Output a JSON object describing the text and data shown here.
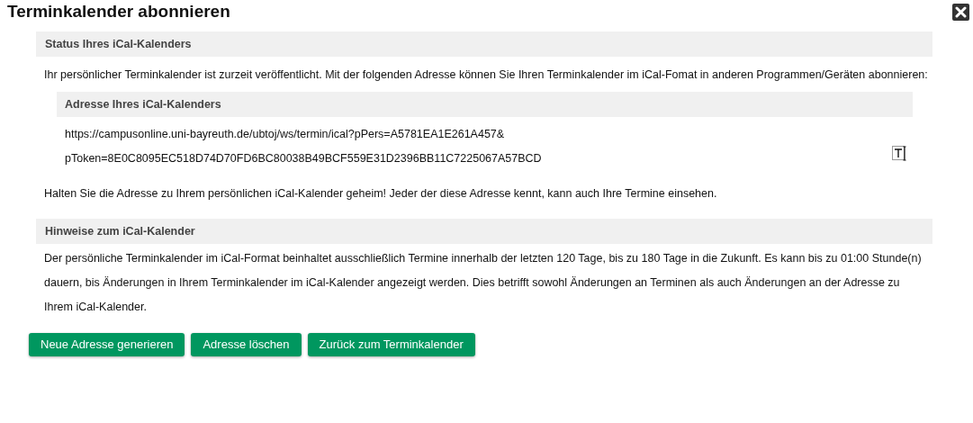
{
  "dialog": {
    "title": "Terminkalender abonnieren"
  },
  "status_section": {
    "heading": "Status Ihres iCal-Kalenders",
    "intro": "Ihr persönlicher Terminkalender ist zurzeit veröffentlicht. Mit der folgenden Adresse können Sie Ihren Terminkalender im iCal-Fomat in anderen Programmen/Geräten abonnieren:",
    "address_heading": "Adresse Ihres iCal-Kalenders",
    "address_lines": [
      "https://campusonline.uni-bayreuth.de/ubtoj/ws/termin/ical?pPers=A5781EA1E261A457&",
      "pToken=8E0C8095EC518D74D70FD6BC80038B49BCF559E31D2396BB11C7225067A57BCD"
    ],
    "warning": "Halten Sie die Adresse zu Ihrem persönlichen iCal-Kalender geheim! Jeder der diese Adresse kennt, kann auch Ihre Termine einsehen."
  },
  "notes_section": {
    "heading": "Hinweise zum iCal-Kalender",
    "text": "Der persönliche Terminkalender im iCal-Format beinhaltet ausschließlich Termine innerhalb der letzten 120 Tage, bis zu 180 Tage in die Zukunft. Es kann bis zu 01:00 Stunde(n) dauern, bis Änderungen in Ihrem Terminkalender im iCal-Kalender angezeigt werden. Dies betrifft sowohl Änderungen an Terminen als auch Änderungen an der Adresse zu Ihrem iCal-Kalender."
  },
  "buttons": [
    "Neue Adresse generieren",
    "Adresse löschen",
    "Zurück zum Terminkalender"
  ]
}
